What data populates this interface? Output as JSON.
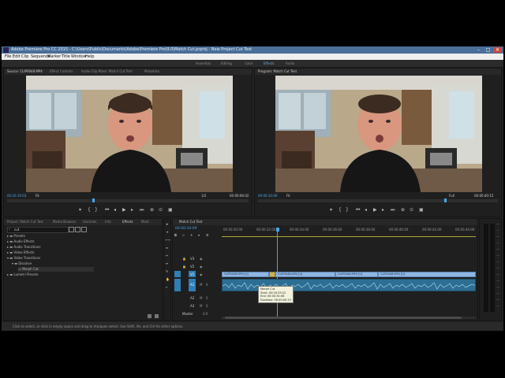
{
  "app": {
    "title": "Adobe Premiere Pro CC 2015 - C:\\Users\\Public\\Documents\\Adobe\\Premiere Pro\\9.0\\Match Cut.prproj - New Project Cut Test",
    "window_buttons": [
      "–",
      "□",
      "✕"
    ]
  },
  "menu": [
    "File",
    "Edit",
    "Clip",
    "Sequence",
    "Marker",
    "Title",
    "Window",
    "Help"
  ],
  "workspaces": [
    "Assembly",
    "Editing",
    "Color",
    "Effects",
    "Audio"
  ],
  "source_monitor": {
    "tabs": [
      "Source: CLIP0048.MP4",
      "Effect Controls",
      "Audio Clip Mixer: Match Cut Test",
      "Metadata"
    ],
    "timecode_left": "00:16:19:03",
    "zoom": "Fit",
    "scale": "1/2",
    "timecode_right": "00:00:06:02"
  },
  "program_monitor": {
    "title": "Program: Match Cut Test",
    "timecode_left": "00:00:34:09",
    "zoom": "Fit",
    "scale": "Full",
    "timecode_right": "00:00:40:15"
  },
  "transport_icons": [
    "marker-icon",
    "in-point-icon",
    "out-point-icon",
    "go-to-in-icon",
    "step-back-icon",
    "play-icon",
    "step-forward-icon",
    "go-to-out-icon",
    "insert-icon",
    "overwrite-icon",
    "export-frame-icon"
  ],
  "effects_panel": {
    "tabs": [
      "Project: Match Cut Test",
      "Media Browser",
      "Libraries",
      "Info",
      "Effects",
      "Mark"
    ],
    "search_value": "cut",
    "tree": [
      {
        "label": "Presets",
        "indent": 0
      },
      {
        "label": "Audio Effects",
        "indent": 0
      },
      {
        "label": "Audio Transitions",
        "indent": 0
      },
      {
        "label": "Video Effects",
        "indent": 0
      },
      {
        "label": "Video Transitions",
        "indent": 0
      },
      {
        "label": "Dissolve",
        "indent": 1
      },
      {
        "label": "Morph Cut",
        "indent": 2
      },
      {
        "label": "Lumetri Presets",
        "indent": 0
      }
    ]
  },
  "timeline": {
    "tab": "Match Cut Test",
    "timecode": "00:00:34:09",
    "ruler": [
      "00:00:30:00",
      "00:00:32:00",
      "00:00:34:00",
      "00:00:36:00",
      "00:00:38:00",
      "00:00:40:00",
      "00:00:42:00",
      "00:00:44:00"
    ],
    "video_tracks": [
      "V3",
      "V2",
      "V1"
    ],
    "audio_tracks": [
      "A1",
      "A2",
      "A3"
    ],
    "master_label": "Master",
    "clips": [
      "CLIP0048.MP4 [V]",
      "CLIP0048.MP4 [V]",
      "CLIP0048.MP4 [V]",
      "CLIP0048.MP4 [V]"
    ],
    "tooltip": [
      "Morph Cut",
      "Start: 00:00:33:22",
      "End: 00:00:34:08",
      "Duration: 00:00:00:15"
    ]
  },
  "status_bar": "Click to select, or click in empty space and drag to marquee select. Use Shift, Alt, and Ctrl for other options.",
  "colors": {
    "accent": "#46a6e6",
    "titlebar": "#4a6f99",
    "clip": "#8fb5e2",
    "audio_clip": "#2d6e93"
  }
}
